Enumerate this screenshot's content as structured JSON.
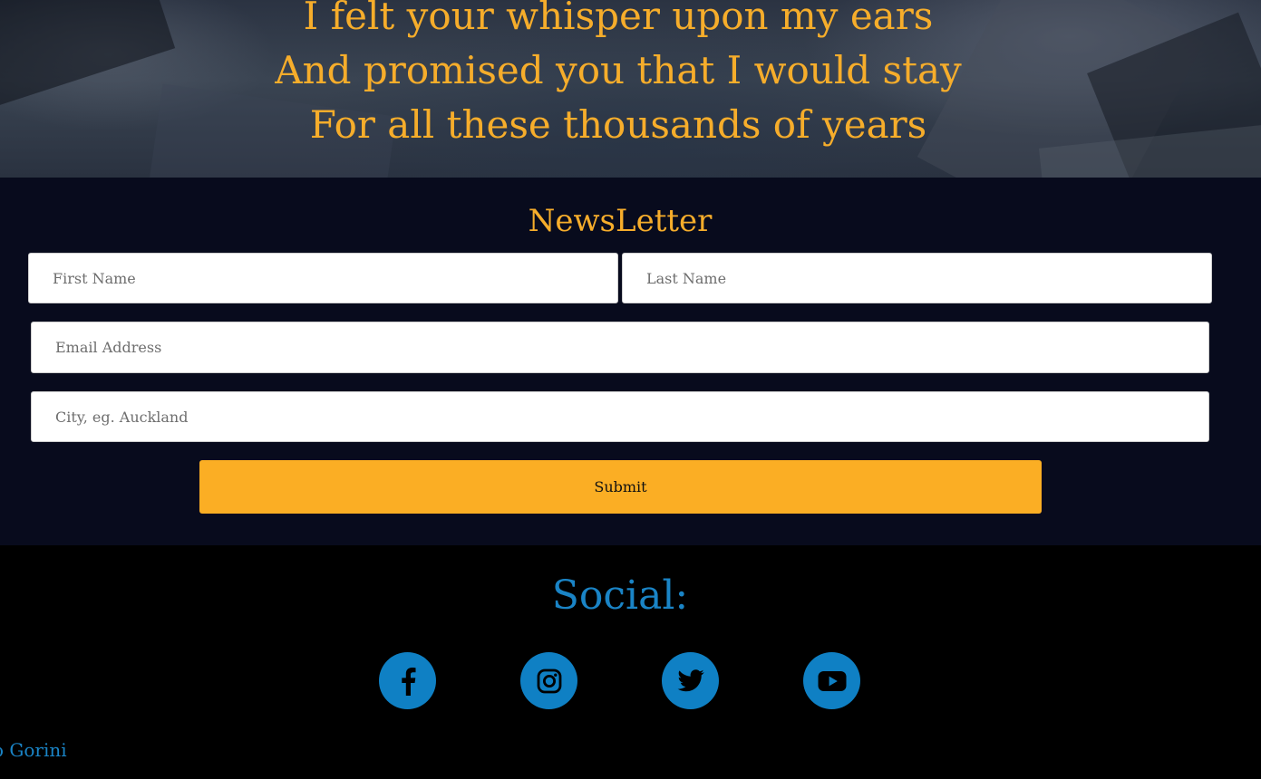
{
  "hero": {
    "poem_lines": [
      "I felt your whisper upon my ears",
      "And promised you that I would stay",
      "For all these thousands of years"
    ]
  },
  "newsletter": {
    "title": "NewsLetter",
    "first_name_placeholder": "First Name",
    "last_name_placeholder": "Last Name",
    "email_placeholder": "Email Address",
    "city_placeholder": "City, eg. Auckland",
    "submit_label": "Submit"
  },
  "social": {
    "title": "Social:",
    "buttons": [
      {
        "icon": "facebook-icon"
      },
      {
        "icon": "instagram-icon"
      },
      {
        "icon": "twitter-icon"
      },
      {
        "icon": "youtube-icon"
      }
    ],
    "credit": "o Gorini"
  },
  "colors": {
    "accent_orange": "#fbae24",
    "accent_blue": "#0f80c4",
    "newsletter_bg": "#080b1d",
    "footer_bg": "#000000"
  }
}
